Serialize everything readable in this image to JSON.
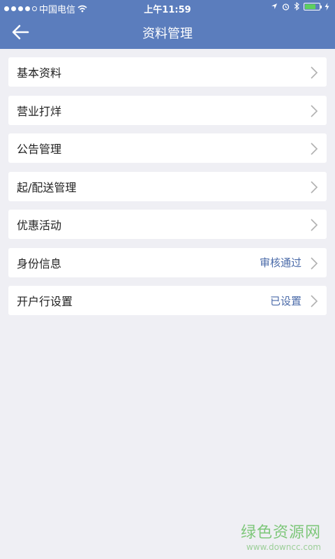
{
  "statusbar": {
    "carrier": "中国电信",
    "time": "上午11:59"
  },
  "navbar": {
    "title": "资料管理"
  },
  "menu": [
    {
      "label": "基本资料",
      "value": ""
    },
    {
      "label": "营业打烊",
      "value": ""
    },
    {
      "label": "公告管理",
      "value": ""
    },
    {
      "label": "起/配送管理",
      "value": ""
    },
    {
      "label": "优惠活动",
      "value": ""
    },
    {
      "label": "身份信息",
      "value": "审核通过"
    },
    {
      "label": "开户行设置",
      "value": "已设置"
    }
  ],
  "watermark": {
    "main": "绿色资源网",
    "sub": "www.downcc.com"
  },
  "colors": {
    "header": "#5b7dbd",
    "value_text": "#4a6aa8",
    "background": "#efeff4"
  }
}
